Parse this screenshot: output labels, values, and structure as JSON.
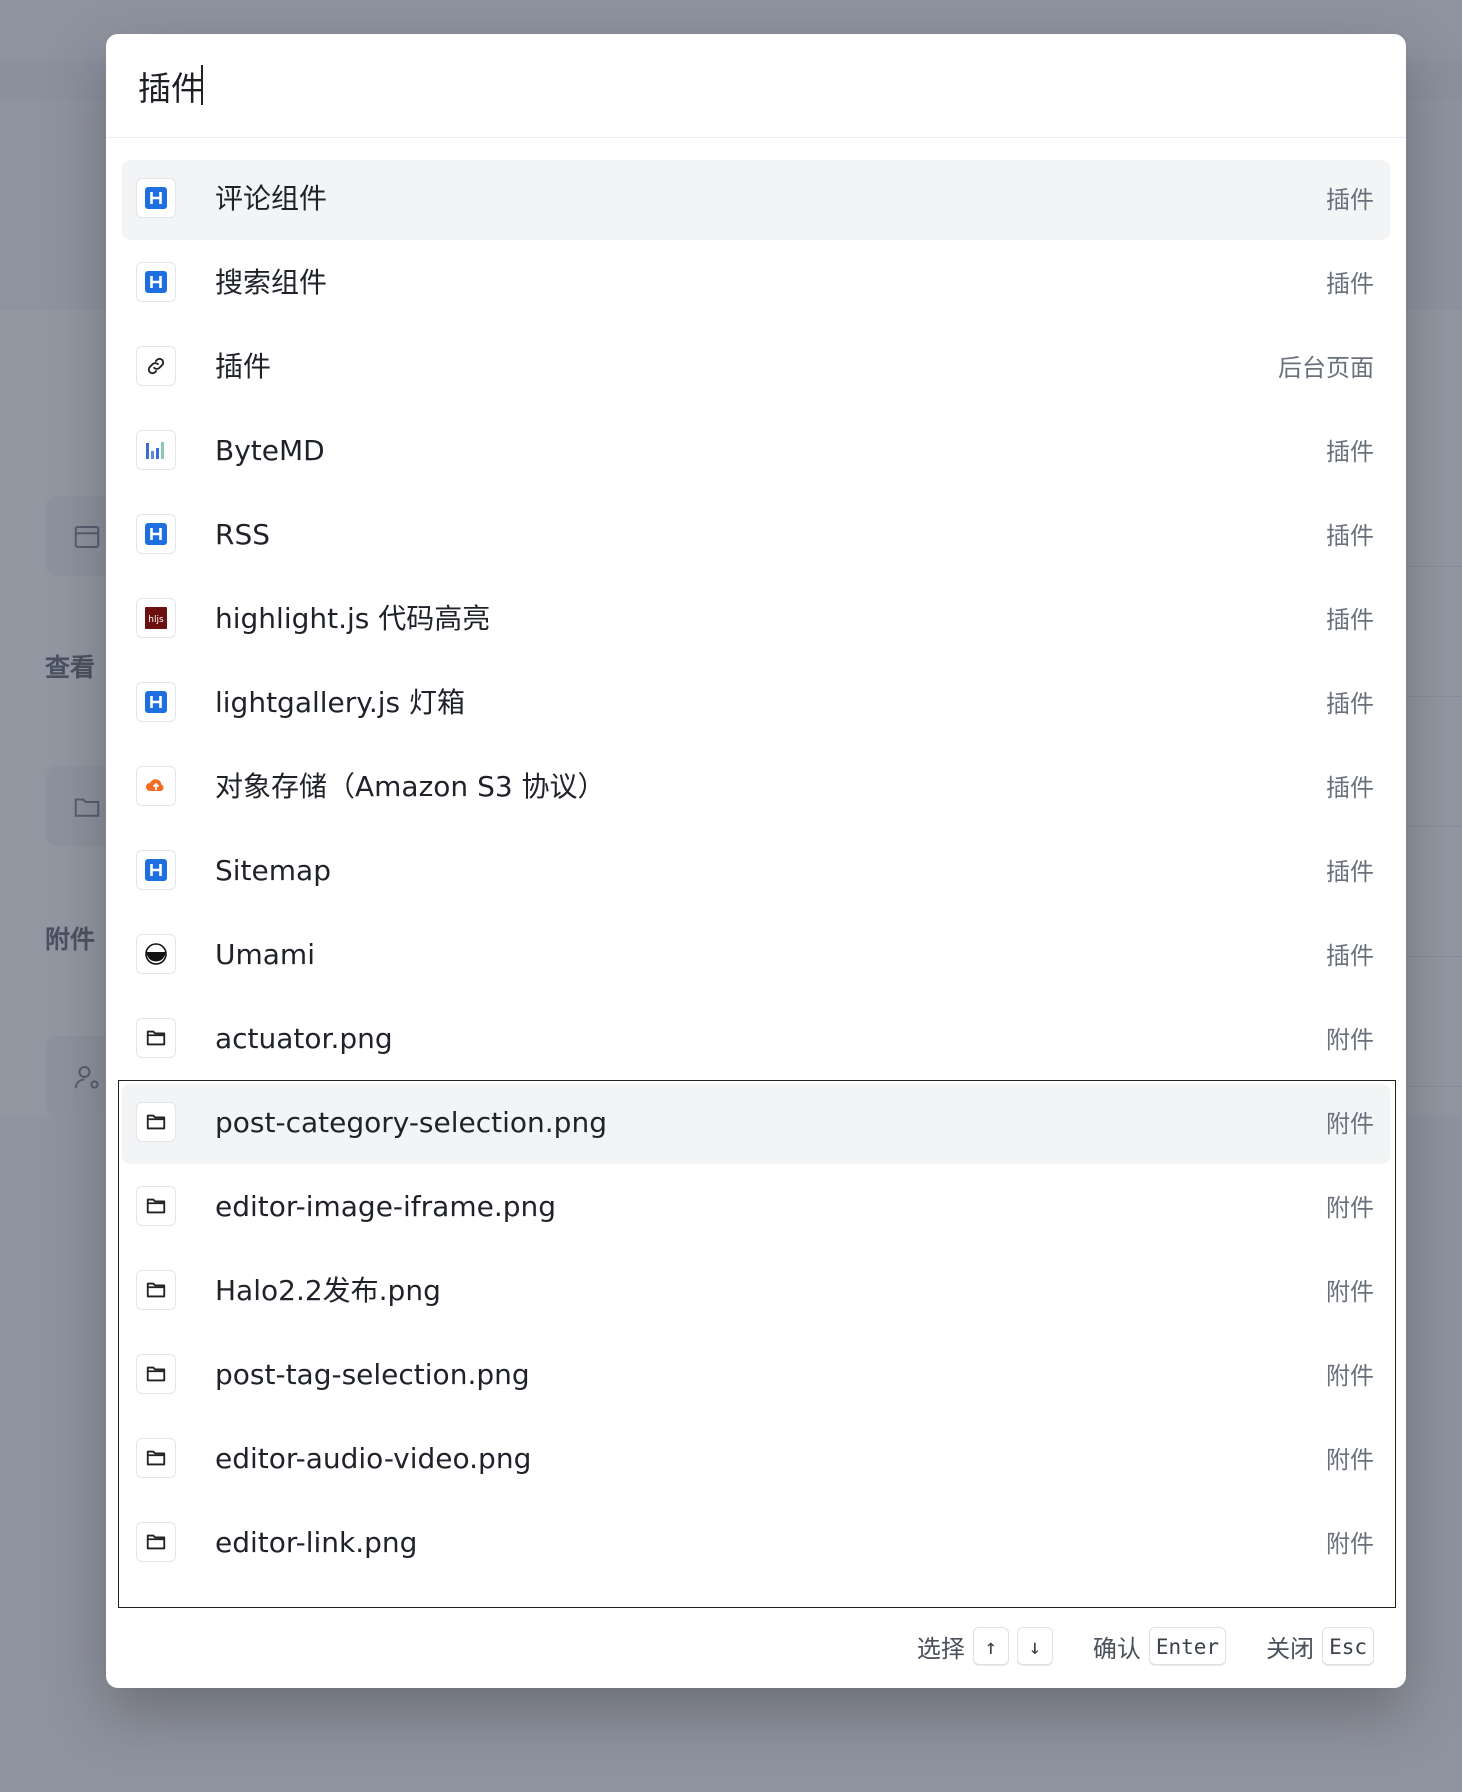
{
  "search": {
    "value": "插件",
    "placeholder": ""
  },
  "background": {
    "labels": [
      "查看",
      "附件"
    ]
  },
  "results": [
    {
      "title": "评论组件",
      "type": "插件",
      "icon": "halo-h-icon",
      "active": true
    },
    {
      "title": "搜索组件",
      "type": "插件",
      "icon": "halo-h-icon"
    },
    {
      "title": "插件",
      "type": "后台页面",
      "icon": "link-icon"
    },
    {
      "title": "ByteMD",
      "type": "插件",
      "icon": "bar-chart-icon"
    },
    {
      "title": "RSS",
      "type": "插件",
      "icon": "halo-h-icon"
    },
    {
      "title": "highlight.js 代码高亮",
      "type": "插件",
      "icon": "hljs-icon"
    },
    {
      "title": "lightgallery.js 灯箱",
      "type": "插件",
      "icon": "halo-h-icon"
    },
    {
      "title": "对象存储（Amazon S3 协议）",
      "type": "插件",
      "icon": "cloud-storage-icon"
    },
    {
      "title": "Sitemap",
      "type": "插件",
      "icon": "halo-h-icon"
    },
    {
      "title": "Umami",
      "type": "插件",
      "icon": "umami-icon"
    },
    {
      "title": "actuator.png",
      "type": "附件",
      "icon": "folder-icon"
    },
    {
      "title": "post-category-selection.png",
      "type": "附件",
      "icon": "folder-icon",
      "active": true
    },
    {
      "title": "editor-image-iframe.png",
      "type": "附件",
      "icon": "folder-icon"
    },
    {
      "title": "Halo2.2发布.png",
      "type": "附件",
      "icon": "folder-icon"
    },
    {
      "title": "post-tag-selection.png",
      "type": "附件",
      "icon": "folder-icon"
    },
    {
      "title": "editor-audio-video.png",
      "type": "附件",
      "icon": "folder-icon"
    },
    {
      "title": "editor-link.png",
      "type": "附件",
      "icon": "folder-icon"
    }
  ],
  "footer": {
    "select_label": "选择",
    "up_key": "↑",
    "down_key": "↓",
    "confirm_label": "确认",
    "enter_key": "Enter",
    "close_label": "关闭",
    "esc_key": "Esc"
  },
  "colors": {
    "halo_blue": "#1e6fe0",
    "hljs_red": "#6b0f0f",
    "cloud_orange": "#f36b23",
    "overlay": "#3a4256"
  }
}
